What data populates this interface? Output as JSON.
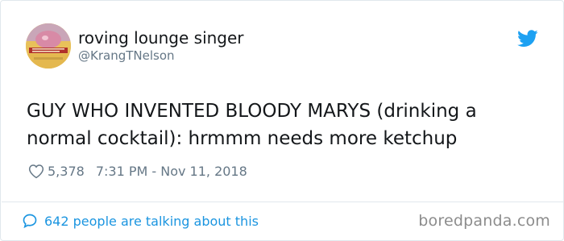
{
  "user": {
    "display_name": "roving lounge singer",
    "handle": "@KrangTNelson"
  },
  "tweet": {
    "text": "GUY WHO INVENTED BLOODY MARYS (drinking a normal cocktail): hrmmm needs more ketchup",
    "likes": "5,378",
    "timestamp": "7:31 PM - Nov 11, 2018"
  },
  "footer": {
    "talking_text": "642 people are talking about this"
  },
  "watermark": "boredpanda.com",
  "colors": {
    "twitter_blue": "#1da1f2",
    "link_blue": "#1b95e0",
    "text": "#14171a",
    "muted": "#657786"
  },
  "icons": {
    "brand": "twitter-bird-icon",
    "like": "heart-icon",
    "reply": "speech-bubble-icon"
  }
}
